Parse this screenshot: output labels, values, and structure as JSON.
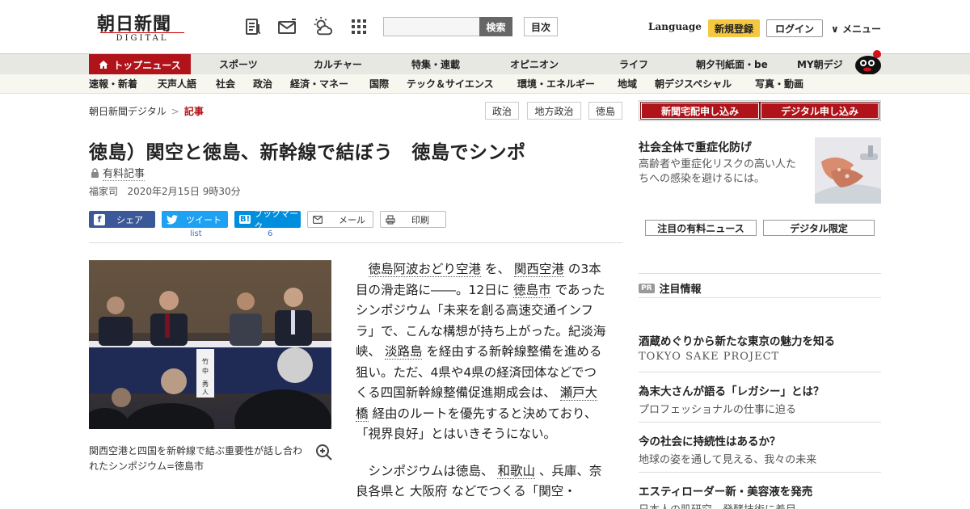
{
  "header": {
    "logo_main": "朝日新聞",
    "logo_sub": "DIGITAL",
    "icons": [
      "newspaper-icon",
      "mail-icon",
      "weather-icon",
      "apps-icon"
    ],
    "search_placeholder": "",
    "search_button": "検索",
    "toc_button": "目次",
    "language": "Language",
    "signup": "新規登録",
    "login": "ログイン",
    "menu": "メニュー"
  },
  "nav_primary": {
    "active": "トップニュース",
    "items": [
      "スポーツ",
      "カルチャー",
      "特集・連載",
      "オピニオン",
      "ライフ",
      "朝夕刊紙面・be",
      "MY朝デジ"
    ]
  },
  "nav_secondary": {
    "items": [
      "速報・新着",
      "天声人語",
      "社会",
      "政治",
      "経済・マネー",
      "国際",
      "テック＆サイエンス",
      "環境・エネルギー",
      "地域",
      "朝デジスペシャル",
      "写真・動画"
    ]
  },
  "breadcrumb": {
    "home": "朝日新聞デジタル",
    "sep": ">",
    "current": "記事"
  },
  "tags": [
    "政治",
    "地方政治",
    "徳島"
  ],
  "article": {
    "headline": "徳島）関空と徳島、新幹線で結ぼう　徳島でシンポ",
    "paid_label": "有料記事",
    "author": "福家司",
    "datetime": "2020年2月15日 9時30分",
    "caption": "関西空港と四国を新幹線で結ぶ重要性が話し合われたシンポジウム=徳島市",
    "placard_text": "竹中 秀人"
  },
  "share": {
    "facebook": "シェア",
    "twitter": "ツイート",
    "twitter_count": "list",
    "hatena": "ブックマーク",
    "hatena_count": "6",
    "mail": "メール",
    "print": "印刷"
  },
  "body": {
    "p1": [
      {
        "t": "徳島阿波おどり空港",
        "link": true
      },
      {
        "t": " を、 ",
        "link": false
      },
      {
        "t": "関西空港",
        "link": true
      },
      {
        "t": " の3本目の滑走路に――。12日に ",
        "link": false
      },
      {
        "t": "徳島市",
        "link": true
      },
      {
        "t": " であったシンポジウム「未来を創る高速交通インフラ」で、こんな構想が持ち上がった。紀淡海峡、 ",
        "link": false
      },
      {
        "t": "淡路島",
        "link": true
      },
      {
        "t": " を経由する新幹線整備を進める狙い。ただ、4県や4県の経済団体などでつくる四国新幹線整備促進期成会は、 ",
        "link": false
      },
      {
        "t": "瀬戸大橋",
        "link": true
      },
      {
        "t": " 経由のルートを優先すると決めており、「視界良好」とはいきそうにない。",
        "link": false
      }
    ],
    "p2": [
      {
        "t": "シンポジウムは徳島、 ",
        "link": false
      },
      {
        "t": "和歌山",
        "link": true
      },
      {
        "t": " 、兵庫、奈良各県と 大阪府 などでつくる「関空・",
        "link": false
      }
    ]
  },
  "sidebar": {
    "btn_newspaper": "新聞宅配申し込み",
    "btn_digital": "デジタル申し込み",
    "promo_title": "社会全体で重症化防げ",
    "promo_desc": "高齢者や重症化リスクの高い人たちへの感染を避けるには。",
    "tab1": "注目の有料ニュース",
    "tab2": "デジタル限定",
    "pr_badge": "PR",
    "pr_heading": "注目情報",
    "ads": [
      {
        "title": "酒蔵めぐりから新たな東京の魅力を知る",
        "sub": "TOKYO SAKE PROJECT"
      },
      {
        "title": "為末大さんが語る「レガシー」とは？",
        "sub": "プロフェッショナルの仕事に迫る"
      },
      {
        "title": "今の社会に持続性はあるか？",
        "sub": "地球の姿を通して見える、我々の未来"
      },
      {
        "title": "エスティローダー新・美容液を発売",
        "sub": "日本人の肌研究、発酵技術に着目"
      }
    ]
  },
  "colors": {
    "brand_red": "#b0141a",
    "signup_yellow": "#f5c842"
  }
}
